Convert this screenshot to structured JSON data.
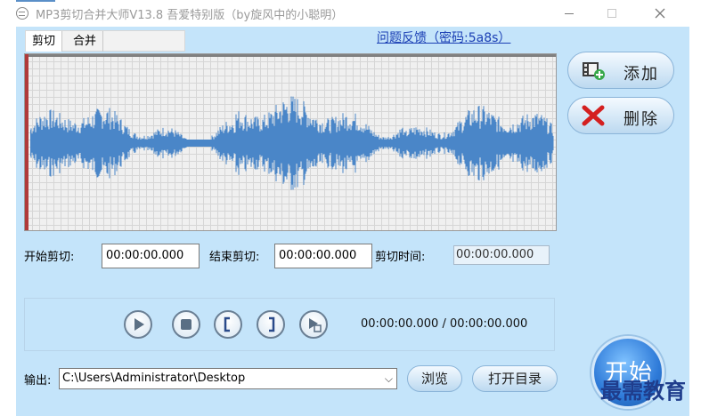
{
  "window": {
    "title": "MP3剪切合并大师V13.8 吾爱特别版（by旋风中的小聪明）"
  },
  "tabs": [
    {
      "label": "剪切"
    },
    {
      "label": "合并"
    }
  ],
  "feedback_link": "问题反馈（密码:5a8s）",
  "side_buttons": {
    "add_label": "添加",
    "delete_label": "删除"
  },
  "cut": {
    "start_label": "开始剪切:",
    "start_value": "00:00:00.000",
    "end_label": "结束剪切:",
    "end_value": "00:00:00.000",
    "duration_label": "剪切时间:",
    "duration_value": "00:00:00.000"
  },
  "player": {
    "time_readout": "00:00:00.000 / 00:00:00.000"
  },
  "output": {
    "label": "输出:",
    "path": "C:\\Users\\Administrator\\Desktop",
    "browse_label": "浏览",
    "open_dir_label": "打开目录"
  },
  "start_button": "开始",
  "watermark": "最需教育",
  "colors": {
    "client_bg": "#c4e4fa",
    "waveform": "#4a86c8",
    "playhead": "#b03a3a",
    "link": "#1a3eb4"
  }
}
